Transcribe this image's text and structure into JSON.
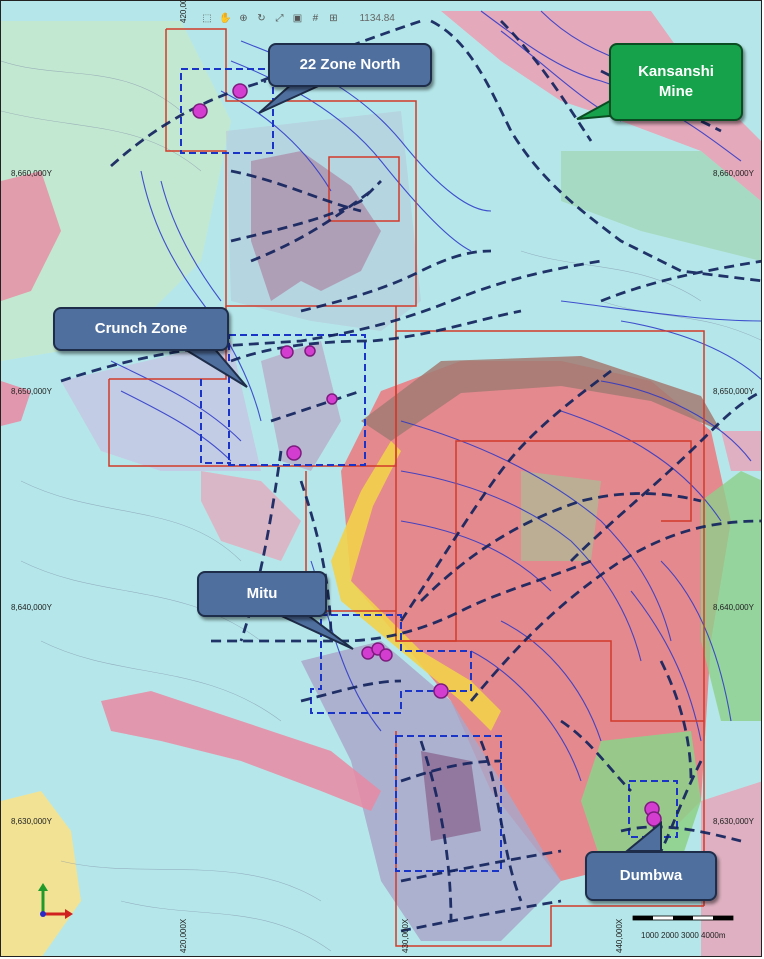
{
  "callouts": {
    "zone22": "22 Zone North",
    "kansanshi": "Kansanshi\nMine",
    "crunch": "Crunch Zone",
    "mitu": "Mitu",
    "dumbwa": "Dumbwa"
  },
  "toolbar": {
    "readout": "1134.84",
    "icons": [
      "select-icon",
      "pan-icon",
      "zoom-icon",
      "rotate-icon",
      "fit-icon",
      "layers-icon",
      "grid-icon",
      "measure-icon"
    ]
  },
  "grid": {
    "y_labels": [
      "8,660,000Y",
      "8,650,000Y",
      "8,640,000Y",
      "8,630,000Y"
    ],
    "x_labels": [
      "420,000X",
      "430,000X",
      "440,000X"
    ]
  },
  "scale_bar": "1000 2000 3000 4000m",
  "colors": {
    "base": "#b5e7ea",
    "granite": "#e98aa3",
    "dome": "#e48a8e",
    "mauve": "#a67a93",
    "green": "#8fd08b",
    "yellow": "#f2d24a",
    "license_line": "#d23a2a",
    "fault_line": "#14245e",
    "contour": "#2a36c8",
    "target": "#d43ed0"
  }
}
